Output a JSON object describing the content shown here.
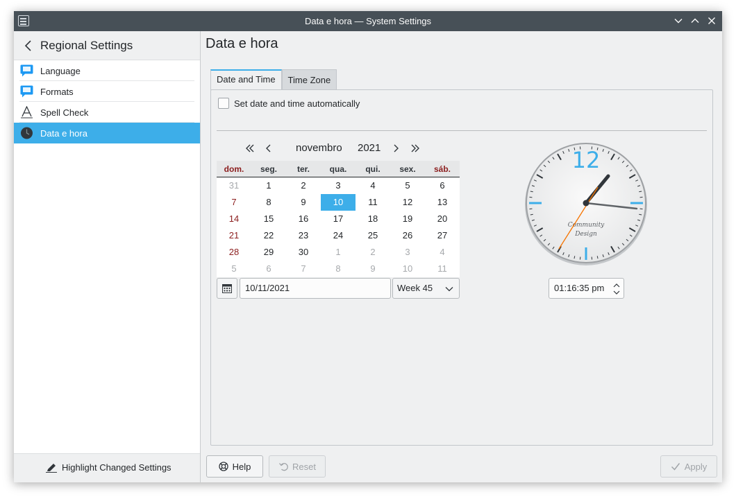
{
  "window": {
    "title": "Data e hora — System Settings"
  },
  "sidebar": {
    "title": "Regional Settings",
    "items": [
      {
        "label": "Language",
        "icon": "language-icon"
      },
      {
        "label": "Formats",
        "icon": "formats-icon"
      },
      {
        "label": "Spell Check",
        "icon": "spell-check-icon"
      },
      {
        "label": "Data e hora",
        "icon": "clock-icon",
        "active": true
      }
    ],
    "footer_button": "Highlight Changed Settings"
  },
  "page": {
    "title": "Data e hora",
    "tabs": [
      {
        "label": "Date and Time",
        "active": true
      },
      {
        "label": "Time Zone",
        "active": false
      }
    ],
    "auto_checkbox": {
      "label": "Set date and time automatically",
      "checked": false
    }
  },
  "calendar": {
    "month": "novembro",
    "year": "2021",
    "weekdays": [
      "dom.",
      "seg.",
      "ter.",
      "qua.",
      "qui.",
      "sex.",
      "sáb."
    ],
    "weeks": [
      [
        "31",
        "1",
        "2",
        "3",
        "4",
        "5",
        "6"
      ],
      [
        "7",
        "8",
        "9",
        "10",
        "11",
        "12",
        "13"
      ],
      [
        "14",
        "15",
        "16",
        "17",
        "18",
        "19",
        "20"
      ],
      [
        "21",
        "22",
        "23",
        "24",
        "25",
        "26",
        "27"
      ],
      [
        "28",
        "29",
        "30",
        "1",
        "2",
        "3",
        "4"
      ],
      [
        "5",
        "6",
        "7",
        "8",
        "9",
        "10",
        "11"
      ]
    ],
    "selected_day": "10",
    "date_value": "10/11/2021",
    "week_value": "Week 45"
  },
  "clock": {
    "twelve_label": "12",
    "brand_line1": "Community",
    "brand_line2": "Design",
    "time_value": "01:16:35 pm",
    "accent_color": "#3daee9",
    "second_hand_color": "#f67400"
  },
  "buttons": {
    "help": "Help",
    "reset": "Reset",
    "apply": "Apply"
  }
}
